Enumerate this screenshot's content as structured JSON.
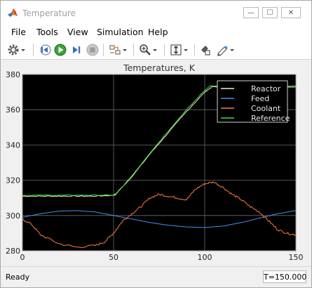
{
  "window": {
    "title": "Temperature",
    "controls": {
      "minimize": "—",
      "maximize": "☐",
      "close": "✕"
    }
  },
  "menu": [
    "File",
    "Tools",
    "View",
    "Simulation",
    "Help"
  ],
  "toolbar": {
    "items": [
      "gear-icon",
      "step-back-icon",
      "run-icon",
      "step-forward-icon",
      "stop-icon",
      "signal-select-icon",
      "zoom-icon",
      "fit-axes-icon",
      "style-icon",
      "highlight-icon"
    ],
    "colors": {
      "run": "#3aa23a",
      "stop": "#a8a8a8"
    }
  },
  "chart_data": {
    "type": "line",
    "title": "Temperatures, K",
    "xlim": [
      0,
      150
    ],
    "ylim": [
      280,
      380
    ],
    "xticks": [
      "0",
      "50",
      "100",
      "150"
    ],
    "yticks": [
      "280",
      "300",
      "320",
      "340",
      "360",
      "380"
    ],
    "grid": true,
    "legend_position": "top-right",
    "background": "#000000",
    "series": [
      {
        "name": "Reactor",
        "color": "#f0f0c8",
        "x": [
          0,
          10,
          20,
          30,
          40,
          50,
          51,
          60,
          70,
          80,
          90,
          100,
          104,
          110,
          120,
          130,
          140,
          150
        ],
        "y": [
          311,
          311,
          311,
          311,
          311,
          311.5,
          312,
          322,
          335,
          347,
          359,
          370,
          373,
          373,
          373,
          373,
          373,
          373
        ]
      },
      {
        "name": "Feed",
        "color": "#4a8ef0",
        "x": [
          0,
          10,
          20,
          30,
          40,
          50,
          60,
          70,
          80,
          90,
          100,
          110,
          120,
          130,
          140,
          150
        ],
        "y": [
          299,
          301,
          302.5,
          302.8,
          302,
          300,
          298,
          296,
          294.5,
          293.5,
          293.2,
          294,
          296,
          298.5,
          301,
          302.8
        ]
      },
      {
        "name": "Coolant",
        "color": "#ff7a40",
        "x": [
          0,
          5,
          10,
          20,
          30,
          40,
          45,
          50,
          55,
          60,
          65,
          70,
          75,
          80,
          85,
          90,
          95,
          100,
          105,
          110,
          115,
          120,
          125,
          130,
          135,
          140,
          145,
          150
        ],
        "y": [
          298,
          295,
          289,
          284,
          282,
          283,
          285,
          290,
          297,
          301,
          305,
          310,
          312,
          311,
          310,
          309,
          315,
          318,
          319,
          316,
          312,
          309,
          305,
          302,
          297,
          292,
          290,
          289
        ]
      },
      {
        "name": "Reference",
        "color": "#40e040",
        "x": [
          0,
          10,
          20,
          30,
          40,
          50,
          51,
          60,
          70,
          80,
          90,
          100,
          103,
          110,
          120,
          130,
          140,
          150
        ],
        "y": [
          311.5,
          311.5,
          311.5,
          311.5,
          311.5,
          311.5,
          311.5,
          322.5,
          335.5,
          348,
          360,
          371,
          373.5,
          373.5,
          373.5,
          373.5,
          373.5,
          373.5
        ]
      }
    ]
  },
  "status": {
    "left": "Ready",
    "time": "T=150.000"
  }
}
